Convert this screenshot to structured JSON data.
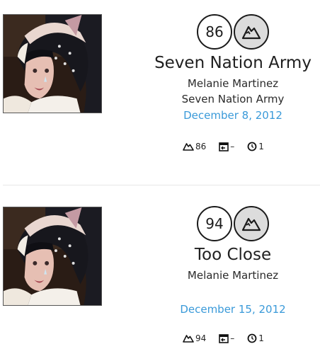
{
  "entries": [
    {
      "score": "86",
      "title": "Seven Nation Army",
      "artist": "Melanie Martinez",
      "album": "Seven Nation Army",
      "date": "December 8, 2012",
      "peak_stat": "86",
      "previous_stat": "–",
      "weeks_stat": "1"
    },
    {
      "score": "94",
      "title": "Too Close",
      "artist": "Melanie Martinez",
      "date": "December 15, 2012",
      "peak_stat": "94",
      "previous_stat": "–",
      "weeks_stat": "1"
    }
  ],
  "icons": {
    "peak": "mountain-icon",
    "previous": "previous-rank-icon",
    "weeks": "clock-icon"
  },
  "colors": {
    "date": "#3a9ad9",
    "peak_badge_fill": "#dcdcdc"
  }
}
